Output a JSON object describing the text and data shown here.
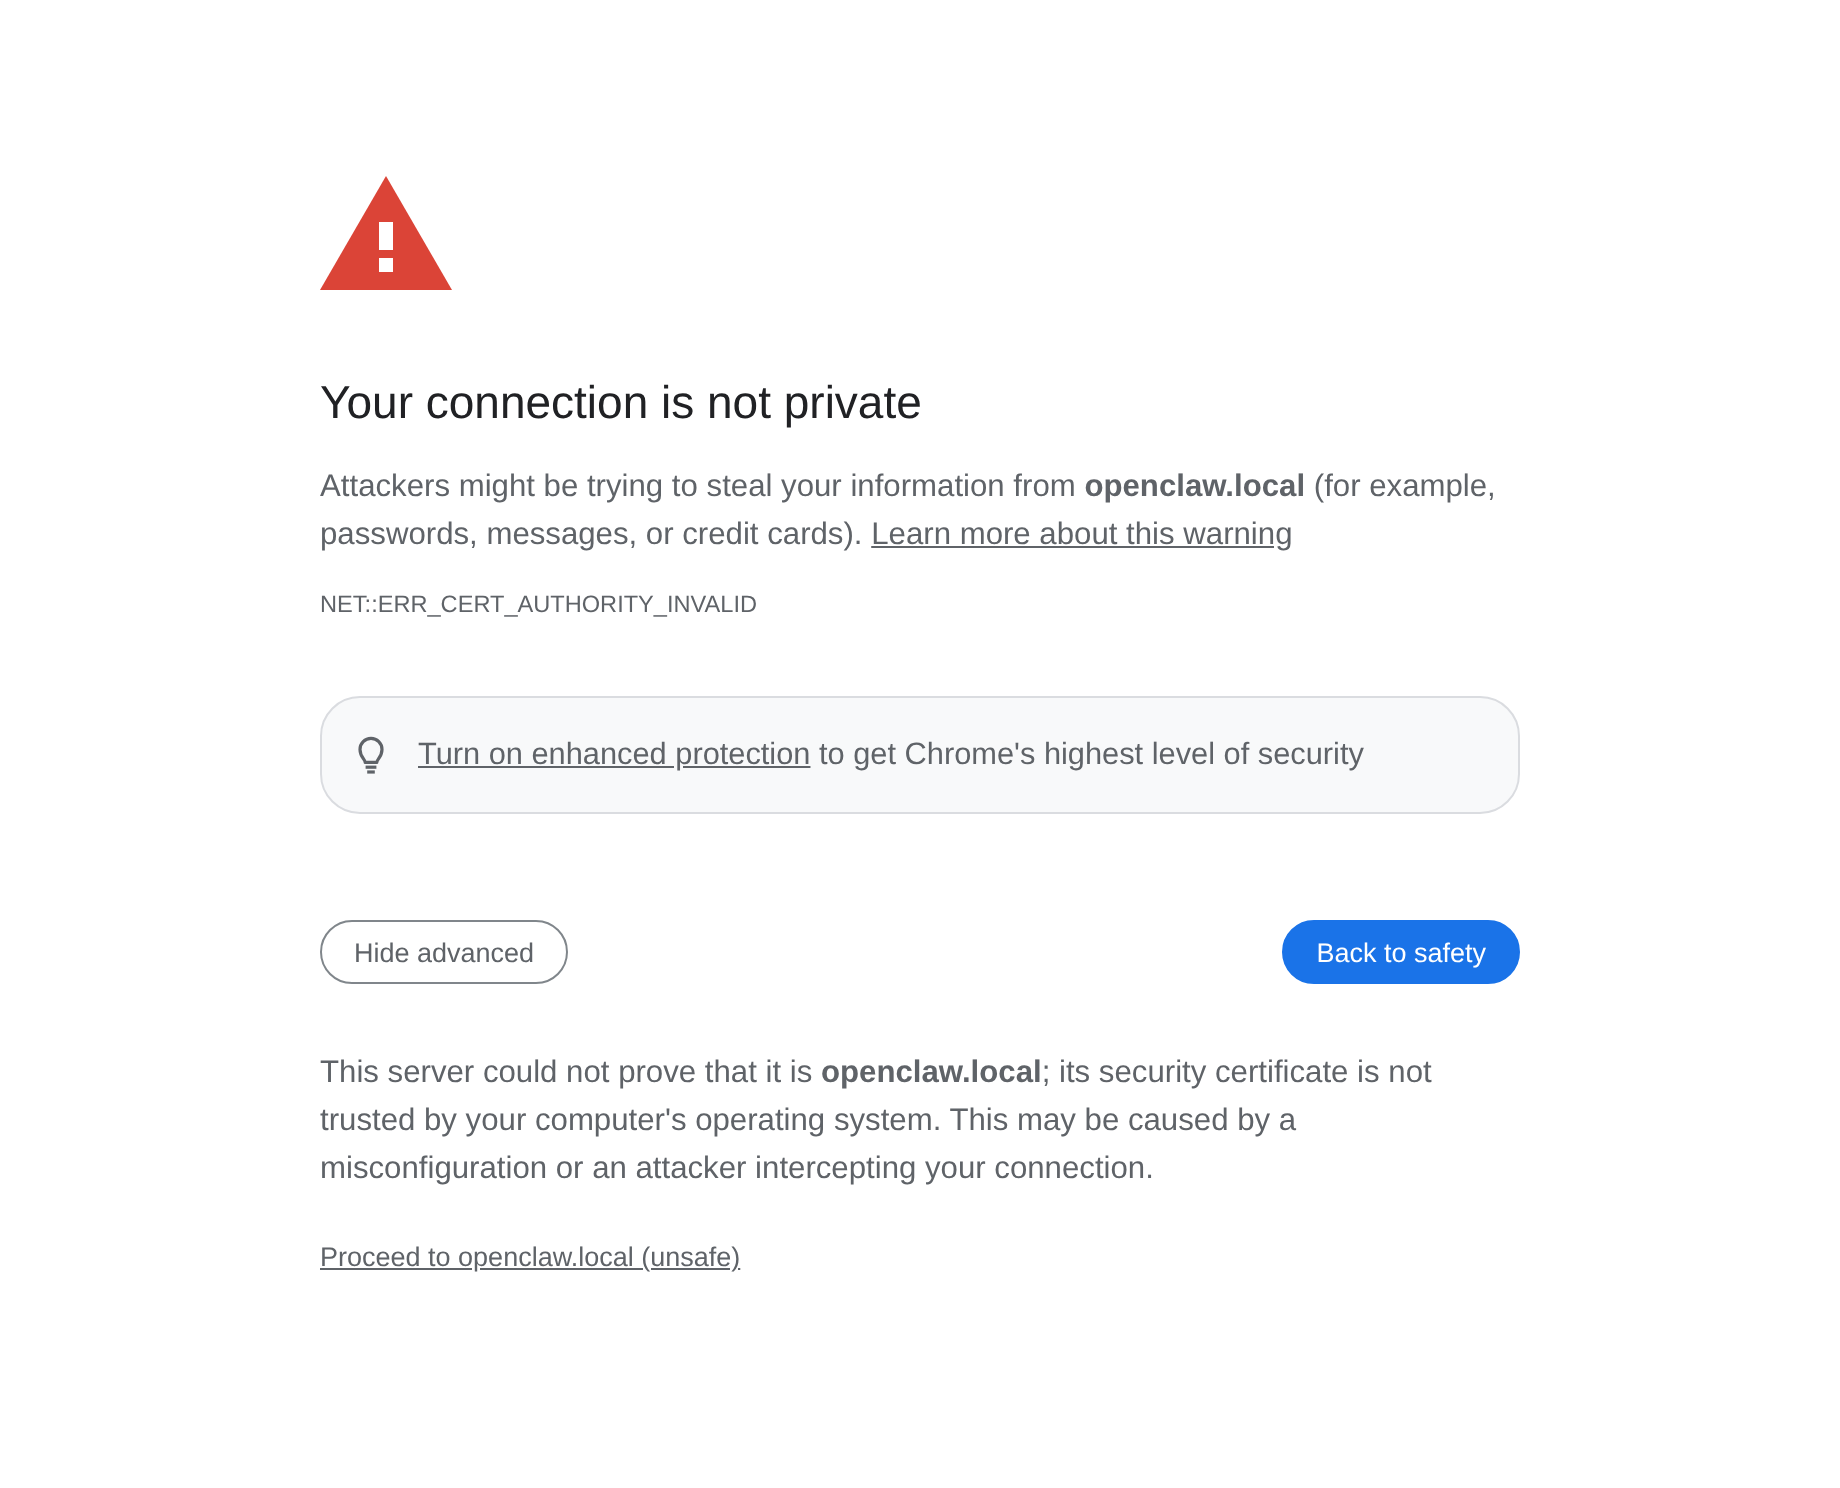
{
  "heading": "Your connection is not private",
  "explanation": {
    "text": "Attackers might be trying to steal your information from **openclaw.local** (for example, passwords, messages, or credit cards).",
    "link": "Learn more about this warning"
  },
  "error_code": "NET::ERR_CERT_AUTHORITY_INVALID",
  "enhanced_protection": {
    "link": "Turn on enhanced protection",
    "text": "to get Chrome's highest level of security"
  },
  "buttons": [
    {
      "label": "Hide advanced",
      "kind": "secondary"
    },
    {
      "label": "Back to safety",
      "kind": "primary"
    }
  ],
  "details": "This server could not prove that it is **openclaw.local**; its security certificate is not trusted by your computer's operating system. This may be caused by a misconfiguration or an attacker intercepting your connection.",
  "proceed_link": "Proceed to openclaw.local (unsafe)"
}
